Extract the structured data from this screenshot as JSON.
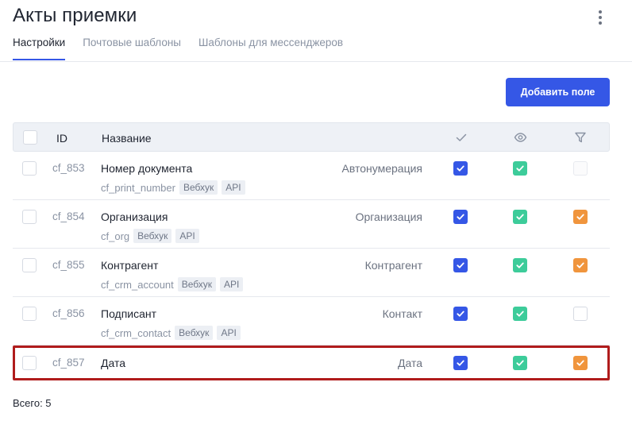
{
  "page": {
    "title": "Акты приемки",
    "tabs": [
      {
        "label": "Настройки",
        "active": true
      },
      {
        "label": "Почтовые шаблоны",
        "active": false
      },
      {
        "label": "Шаблоны для мессенджеров",
        "active": false
      }
    ],
    "add_button_label": "Добавить поле",
    "total_label": "Всего: 5"
  },
  "table": {
    "headers": {
      "id": "ID",
      "name": "Название"
    },
    "header_icons": [
      "check-icon",
      "eye-icon",
      "filter-icon"
    ],
    "rows": [
      {
        "id": "cf_853",
        "name": "Номер документа",
        "code": "cf_print_number",
        "tags": [
          "Вебхук",
          "API"
        ],
        "type": "Автонумерация",
        "c1": "blue",
        "c2": "green",
        "c3": "disabled"
      },
      {
        "id": "cf_854",
        "name": "Организация",
        "code": "cf_org",
        "tags": [
          "Вебхук",
          "API"
        ],
        "type": "Организация",
        "c1": "blue",
        "c2": "green",
        "c3": "orange"
      },
      {
        "id": "cf_855",
        "name": "Контрагент",
        "code": "cf_crm_account",
        "tags": [
          "Вебхук",
          "API"
        ],
        "type": "Контрагент",
        "c1": "blue",
        "c2": "green",
        "c3": "orange"
      },
      {
        "id": "cf_856",
        "name": "Подписант",
        "code": "cf_crm_contact",
        "tags": [
          "Вебхук",
          "API"
        ],
        "type": "Контакт",
        "c1": "blue",
        "c2": "green",
        "c3": "empty"
      },
      {
        "id": "cf_857",
        "name": "Дата",
        "code": "",
        "tags": [],
        "type": "Дата",
        "c1": "blue",
        "c2": "green",
        "c3": "orange"
      }
    ]
  },
  "colors": {
    "accent": "#3557e6",
    "green": "#3dcc9a",
    "orange": "#f0953d",
    "highlight_border": "#b01c1c"
  }
}
